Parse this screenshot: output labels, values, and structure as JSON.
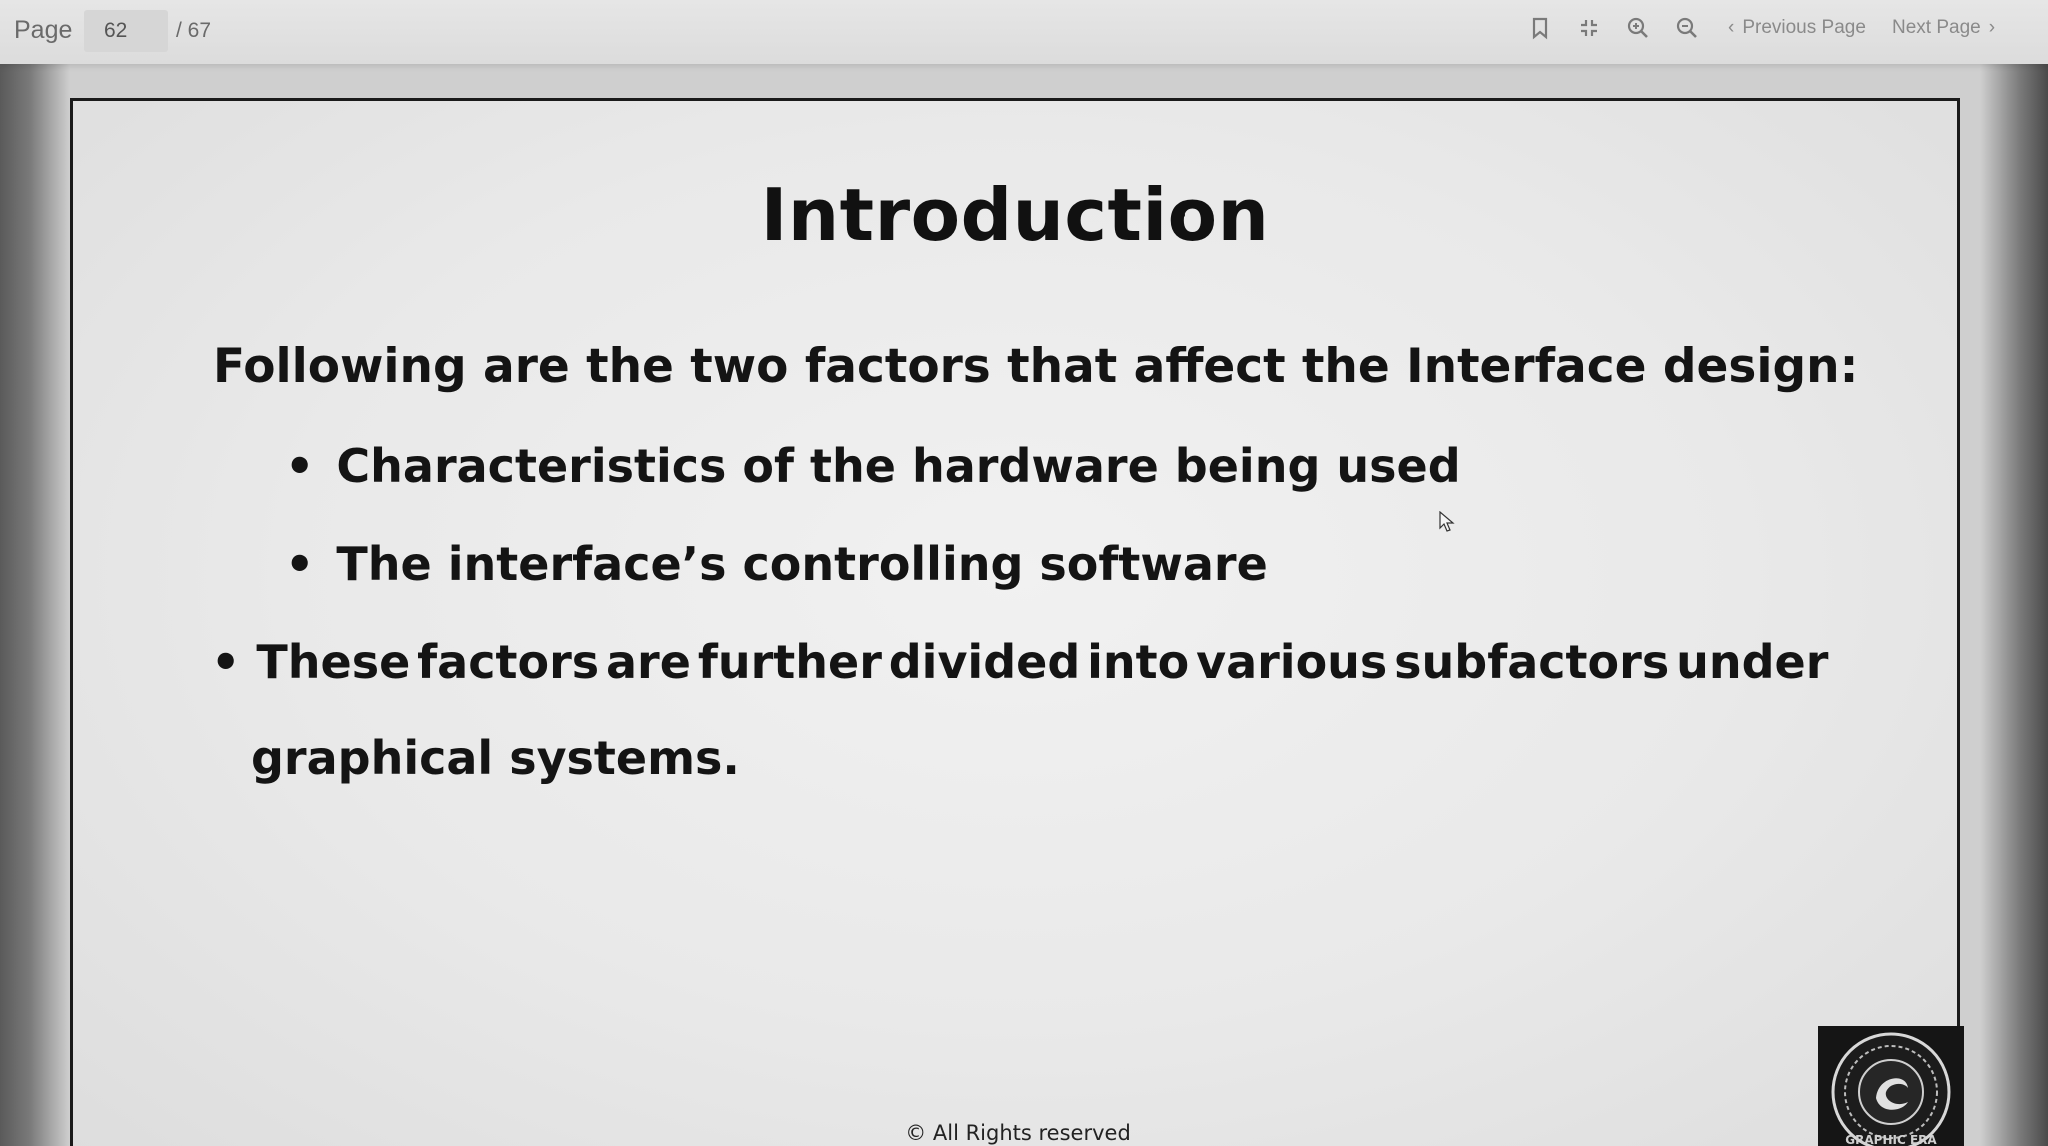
{
  "toolbar": {
    "page_label": "Page",
    "current_page": "62",
    "total_pages": "/ 67",
    "icons": [
      "bookmark-icon",
      "fit-page-icon",
      "zoom-in-icon",
      "zoom-out-icon"
    ],
    "previous_page_label": "Previous Page",
    "next_page_label": "Next Page"
  },
  "slide": {
    "title": "Introduction",
    "intro": "Following are the two factors that affect the Interface design:",
    "sub_bullets": [
      "Characteristics of the hardware being used",
      "The interface’s controlling software"
    ],
    "main_bullet_line1_words": [
      "These",
      "factors",
      "are",
      "further",
      "divided",
      "into",
      "various",
      "subfactors",
      "under"
    ],
    "main_bullet_line2": "graphical systems.",
    "bullet_symbol": "•",
    "footer": "© All Rights reserved",
    "logo_text": "GRAPHIC ERA"
  }
}
